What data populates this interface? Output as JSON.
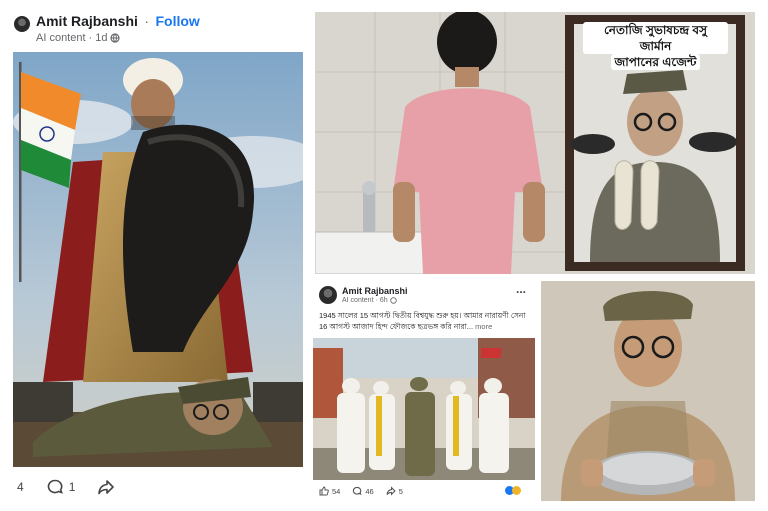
{
  "post1": {
    "author": "Amit Rajbanshi",
    "separator": "·",
    "follow_label": "Follow",
    "meta_label": "AI content",
    "meta_dot": "·",
    "meta_time": "1d",
    "reaction_count": "4",
    "comment_count": "1"
  },
  "photo2": {
    "caption_line1": "নেতাজি সুভাষচন্দ্র বসু জার্মান",
    "caption_line2": "জাপানের এজেন্ট"
  },
  "post2": {
    "author": "Amit Rajbanshi",
    "meta_label": "AI content",
    "meta_dot": "·",
    "meta_time": "6h",
    "more_label": "...",
    "text": "1945 সালের 15 আগস্ট দ্বিতীয় বিশ্বযুদ্ধ শুরু হয়। আমার নারায়ণী সেনা 16 আগস্ট আজাদ হিন্দ ফৌজকে ছত্রভঙ্গ করি  নারা...",
    "text_more": "more",
    "likes": "54",
    "comments": "46",
    "shares": "5"
  },
  "icons": {
    "globe": "globe-icon",
    "comment": "comment-icon",
    "share": "share-icon",
    "like": "like-icon",
    "more": "more-options-icon"
  }
}
